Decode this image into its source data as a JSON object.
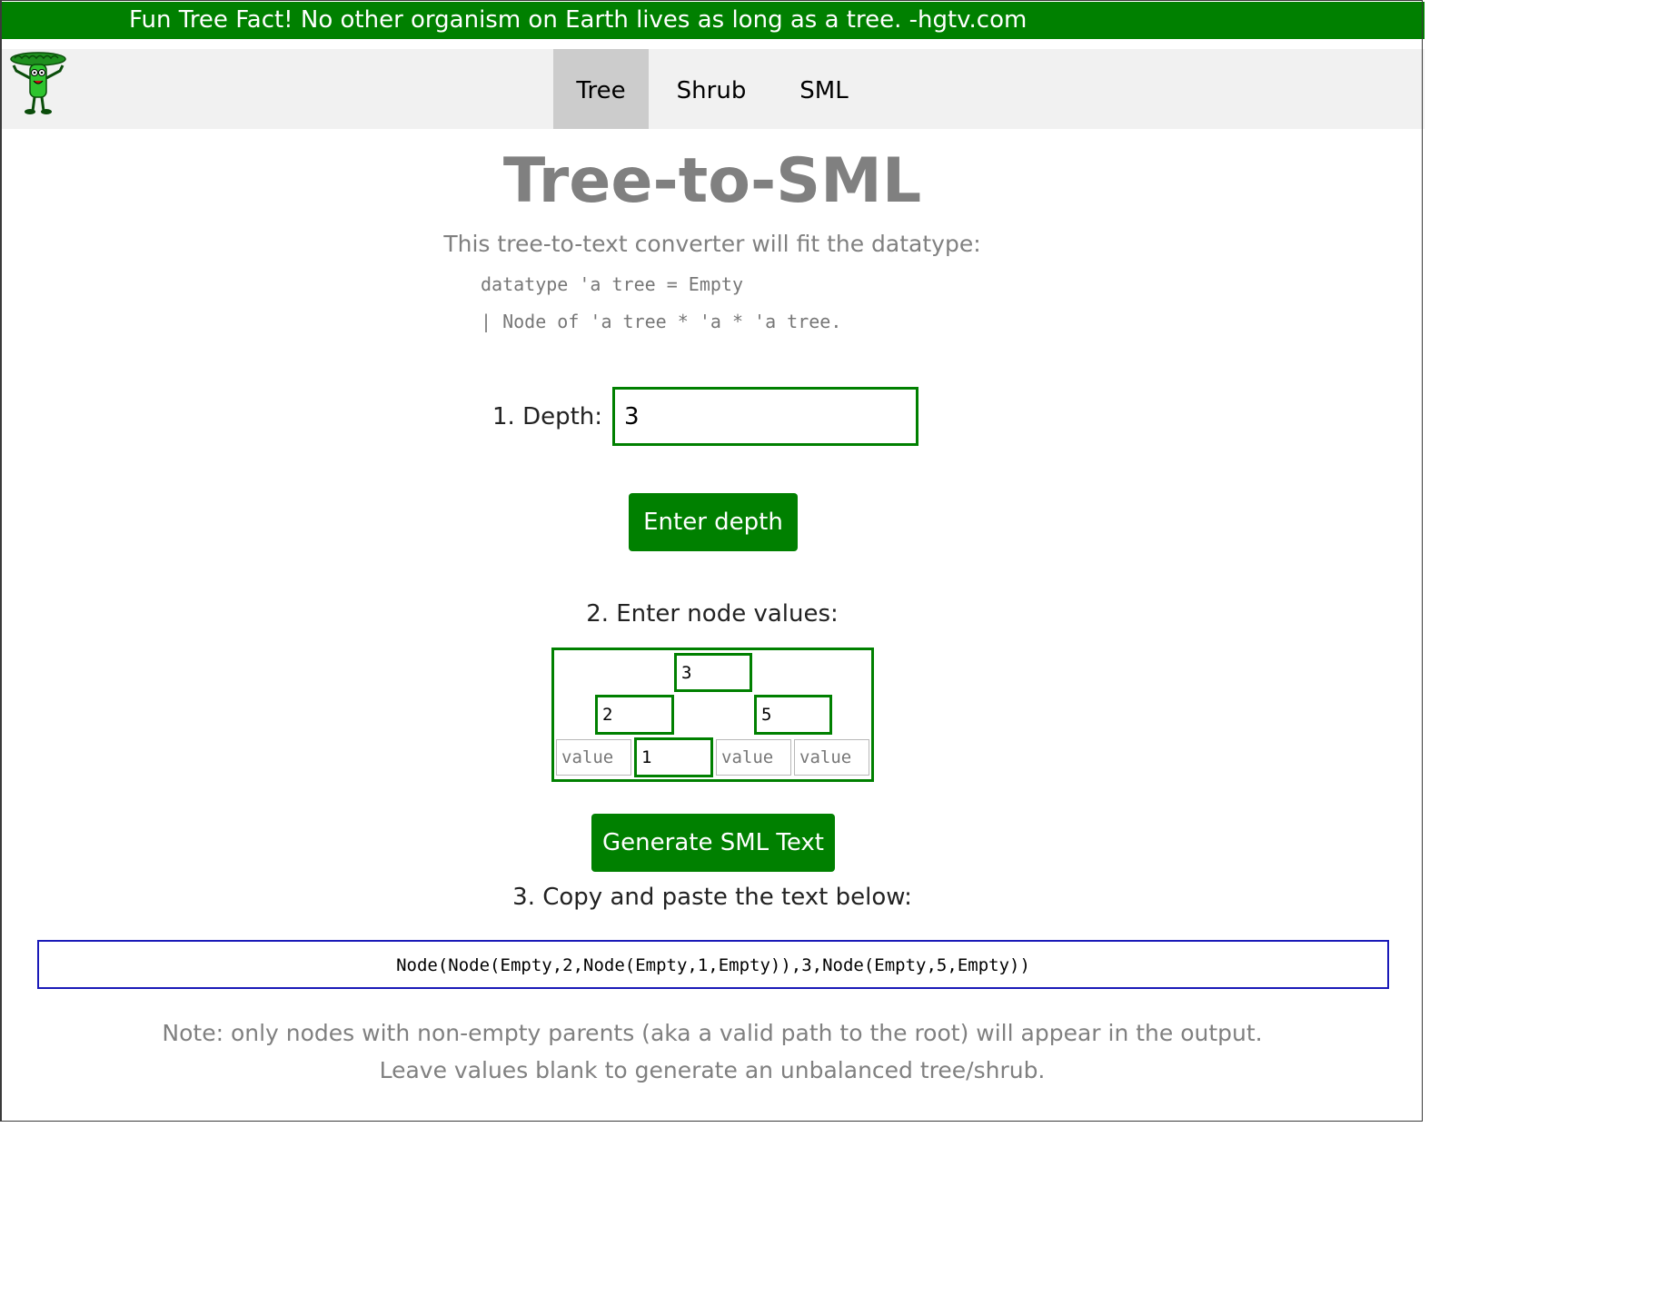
{
  "banner": {
    "fact": "Fun Tree Fact! No other organism on Earth lives as long as a tree. -hgtv.com"
  },
  "nav": {
    "items": [
      {
        "label": "Tree",
        "active": true
      },
      {
        "label": "Shrub",
        "active": false
      },
      {
        "label": "SML",
        "active": false
      }
    ]
  },
  "logo": {
    "icon": "tree-mascot-icon"
  },
  "header": {
    "title": "Tree-to-SML",
    "intro": "This tree-to-text converter will fit the datatype:",
    "code_lines": [
      "datatype 'a tree = Empty",
      "| Node of 'a tree * 'a * 'a tree."
    ]
  },
  "step1": {
    "label": "1. Depth:",
    "depth_value": "3",
    "button_label": "Enter depth"
  },
  "step2": {
    "label": "2. Enter node values:",
    "placeholder": "value",
    "nodes": {
      "root": "3",
      "left": "2",
      "right": "5",
      "left_left": "",
      "left_right": "1",
      "right_left": "",
      "right_right": ""
    },
    "button_label": "Generate SML Text"
  },
  "step3": {
    "label": "3. Copy and paste the text below:",
    "output": "Node(Node(Empty,2,Node(Empty,1,Empty)),3,Node(Empty,5,Empty))"
  },
  "notes": {
    "line1": "Note: only nodes with non-empty parents (aka a valid path to the root) will appear in the output.",
    "line2": "Leave values blank to generate an unbalanced tree/shrub."
  },
  "colors": {
    "brand_green": "#008000",
    "nav_bg": "#f1f1f1",
    "nav_active": "#cccccc",
    "muted_text": "#808080",
    "output_border": "#1a1ab8"
  }
}
